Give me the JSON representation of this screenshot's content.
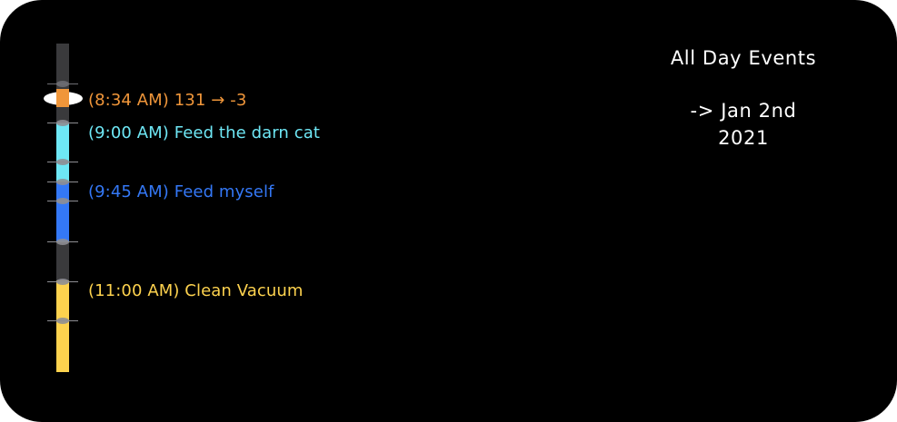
{
  "timeline": {
    "events": [
      {
        "text": "(8:34 AM) 131 → -3",
        "color": "#f0963a"
      },
      {
        "text": "(9:00 AM) Feed the darn cat",
        "color": "#6ee7f5"
      },
      {
        "text": "(9:45 AM) Feed myself",
        "color": "#3478f6"
      },
      {
        "text": "(11:00 AM) Clean Vacuum",
        "color": "#fdd24e"
      }
    ],
    "track_color": "#3a3a3c",
    "background": "#000000"
  },
  "all_day": {
    "title": "All Day Events",
    "line1": "-> Jan 2nd",
    "line2": "2021",
    "color": "#ffffff"
  }
}
